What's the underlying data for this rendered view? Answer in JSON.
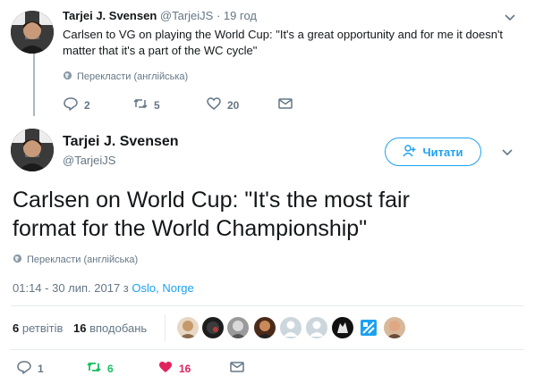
{
  "reply_tweet": {
    "author_name": "Tarjei J. Svensen",
    "handle": "@TarjeiJS",
    "separator": "·",
    "time": "19 год",
    "text": "Carlsen to VG on playing the World Cup: \"It's a great opportunity and for me it doesn't matter that it's a part of the WC cycle\"",
    "translate": "Перекласти (англійська)",
    "actions": {
      "replies": "2",
      "retweets": "5",
      "likes": "20"
    }
  },
  "main_tweet": {
    "author_name": "Tarjei J. Svensen",
    "handle": "@TarjeiJS",
    "follow_label": "Читати",
    "text": "Carlsen on World Cup: \"It's the most fair format for the World Championship\"",
    "translate": "Перекласти (англійська)",
    "timestamp": "01:14 - 30 лип. 2017 з ",
    "location": "Oslo, Norge",
    "retweets_count": "6",
    "retweets_label": "ретвітів",
    "likes_count": "16",
    "likes_label": "вподобань",
    "actions": {
      "replies": "1",
      "retweets": "6",
      "likes": "16"
    }
  },
  "colors": {
    "accent": "#1da1f2",
    "retweet_green": "#17bf63",
    "like_red": "#e0245e",
    "muted": "#657786"
  },
  "icons": [
    "chevron-down-icon",
    "globe-icon",
    "reply-icon",
    "retweet-icon",
    "heart-icon",
    "message-icon",
    "add-user-icon"
  ]
}
